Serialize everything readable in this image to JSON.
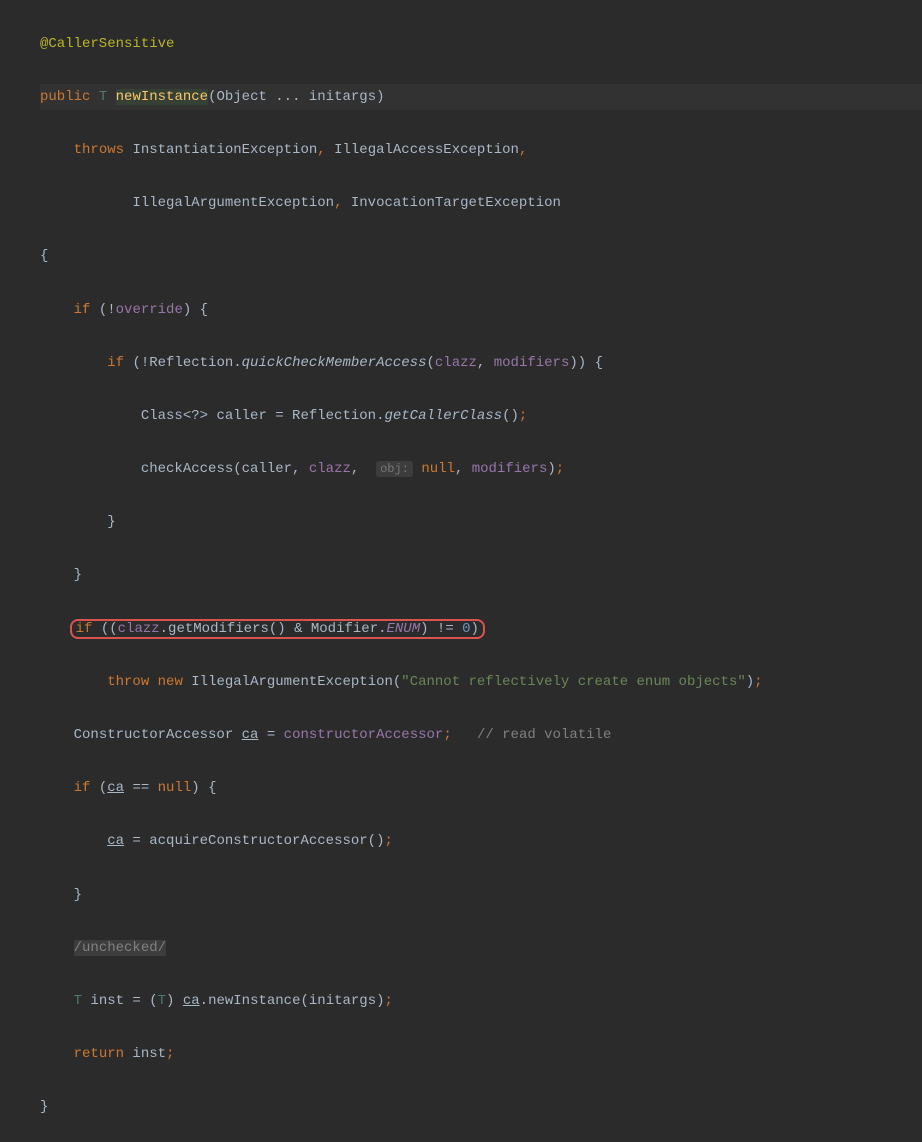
{
  "code": {
    "l1": {
      "annotation": "@CallerSensitive"
    },
    "l2": {
      "public": "public",
      "typeParam": "T",
      "methodName": "newInstance",
      "params": "(Object ... initargs)"
    },
    "l3": {
      "throws": "throws",
      "ex1": "InstantiationException",
      "c1": ",",
      "ex2": "IllegalAccessException",
      "c2": ","
    },
    "l4": {
      "ex3": "IllegalArgumentException",
      "c1": ",",
      "ex4": "InvocationTargetException"
    },
    "l5": {
      "brace": "{"
    },
    "l6": {
      "if": "if",
      "neg": "(!",
      "override": "override",
      "rest": ") {"
    },
    "l7": {
      "if": "if",
      "neg": "(!Reflection.",
      "quickCheck": "quickCheckMemberAccess",
      "open": "(",
      "clazz": "clazz",
      "c1": ", ",
      "modifiers": "modifiers",
      "rest": ")) {"
    },
    "l8": {
      "classDecl": "Class<?> caller = Reflection.",
      "getCaller": "getCallerClass",
      "rest": "()",
      "semi": ";"
    },
    "l9": {
      "check": "checkAccess(caller, ",
      "clazz": "clazz",
      "c1": ", ",
      "hint": "obj:",
      "null": "null",
      "c2": ", ",
      "modifiers": "modifiers",
      "close": ")",
      "semi": ";"
    },
    "l10": {
      "brace": "}"
    },
    "l11": {
      "brace": "}"
    },
    "l12": {
      "if": "if",
      "open": " ((",
      "clazz": "clazz",
      "getMod": ".getModifiers() & Modifier.",
      "enum": "ENUM",
      "close": ") != ",
      "zero": "0",
      "close2": ")"
    },
    "l13": {
      "throw": "throw",
      "sp": " ",
      "new": "new",
      "cls": " IllegalArgumentException(",
      "str": "\"Cannot reflectively create enum objects\"",
      "close": ")",
      "semi": ";"
    },
    "l14": {
      "type": "ConstructorAccessor ",
      "ca": "ca",
      "eq": " = ",
      "constAcc": "constructorAccessor",
      "semi": ";",
      "comment": "// read volatile"
    },
    "l15": {
      "if": "if",
      "open": " (",
      "ca": "ca",
      "eq": " == ",
      "null": "null",
      "rest": ") {"
    },
    "l16": {
      "ca": "ca",
      "eq": " = acquireConstructorAccessor()",
      "semi": ";"
    },
    "l17": {
      "brace": "}"
    },
    "l18": {
      "unchecked": "/unchecked/"
    },
    "l19": {
      "T": "T",
      "inst": " inst = (",
      "T2": "T",
      "close": ") ",
      "ca": "ca",
      "call": ".newInstance(initargs)",
      "semi": ";"
    },
    "l20": {
      "return": "return",
      "inst": " inst",
      "semi": ";"
    },
    "l21": {
      "brace": "}"
    }
  }
}
